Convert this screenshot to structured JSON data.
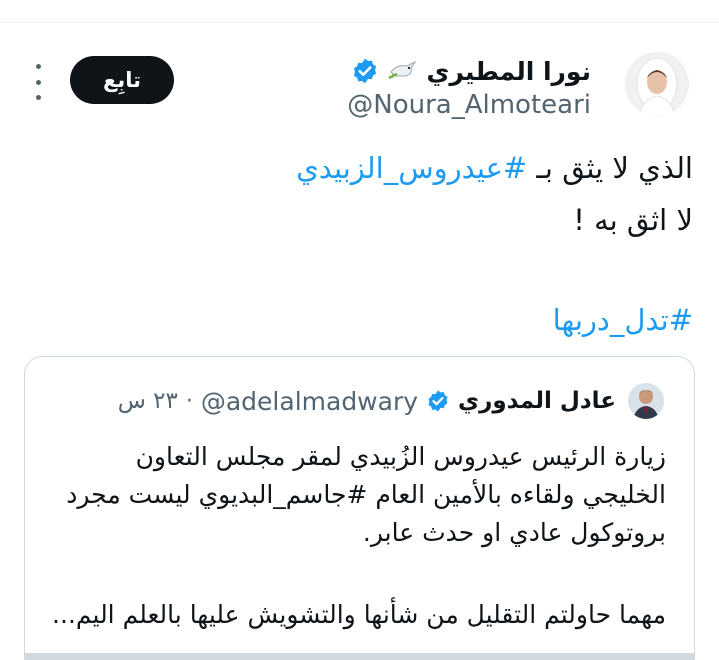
{
  "author": {
    "display_name": "نورا المطيري",
    "handle": "@Noura_Almoteari",
    "verified_icon": "verified-badge-icon",
    "emoji_icon": "dove-with-olive-branch-icon"
  },
  "actions": {
    "follow_label": "تابِع",
    "more_icon": "more-vertical-icon"
  },
  "tweet": {
    "line1_text": "الذي لا يثق بـ ",
    "line1_hashtag": "#عيدروس_الزبيدي",
    "line2_text": "لا اثق به !",
    "line3_hashtag": "#تدل_دربها"
  },
  "quote": {
    "display_name": "عادل المدوري",
    "handle": "@adelalmadwary",
    "time": "٢٣ س",
    "lines": [
      "زيارة الرئيس عيدروس الزُبيدي لمقر مجلس التعاون",
      "الخليجي ولقاءه بالأمين العام #جاسم_البديوي ليست مجرد",
      "بروتوكول عادي او حدث عابر.",
      "مهما حاولتم التقليل من شأنها والتشويش عليها بالعلم اليم..."
    ]
  },
  "colors": {
    "accent": "#1d9bf0",
    "text": "#0f1419",
    "muted": "#536471",
    "border": "#cfd9de"
  }
}
